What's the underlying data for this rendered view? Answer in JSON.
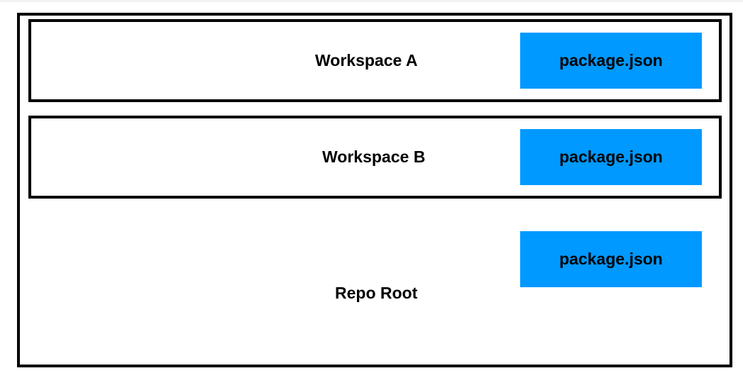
{
  "colors": {
    "border": "#000000",
    "package_fill": "#0099ff",
    "background": "#ffffff"
  },
  "repo_root": {
    "label": "Repo Root",
    "package_label": "package.json"
  },
  "workspaces": [
    {
      "label": "Workspace A",
      "package_label": "package.json"
    },
    {
      "label": "Workspace B",
      "package_label": "package.json"
    }
  ]
}
